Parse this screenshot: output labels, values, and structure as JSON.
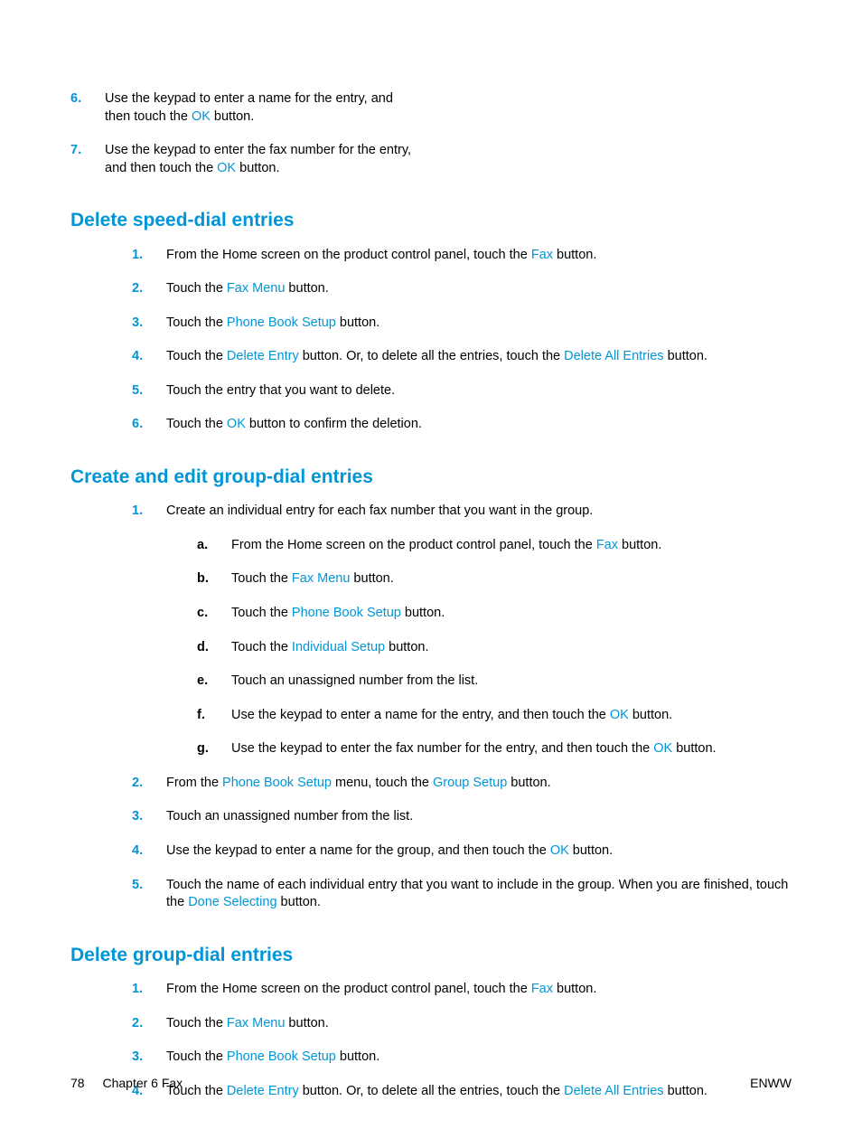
{
  "intro_steps": [
    {
      "n": "6.",
      "parts": [
        {
          "t": "Use the keypad to enter a name for the entry, and then touch the "
        },
        {
          "t": "OK",
          "c": "hp-blue"
        },
        {
          "t": " button."
        }
      ]
    },
    {
      "n": "7.",
      "parts": [
        {
          "t": "Use the keypad to enter the fax number for the entry, and then touch the "
        },
        {
          "t": "OK",
          "c": "hp-blue"
        },
        {
          "t": " button."
        }
      ]
    }
  ],
  "h_delete_speed": "Delete speed-dial entries",
  "delete_speed_steps": [
    {
      "n": "1.",
      "parts": [
        {
          "t": "From the Home screen on the product control panel, touch the "
        },
        {
          "t": "Fax",
          "c": "hp-blue"
        },
        {
          "t": " button."
        }
      ]
    },
    {
      "n": "2.",
      "parts": [
        {
          "t": "Touch the "
        },
        {
          "t": "Fax Menu",
          "c": "hp-blue"
        },
        {
          "t": " button."
        }
      ]
    },
    {
      "n": "3.",
      "parts": [
        {
          "t": "Touch the "
        },
        {
          "t": "Phone Book Setup",
          "c": "hp-blue"
        },
        {
          "t": " button."
        }
      ]
    },
    {
      "n": "4.",
      "parts": [
        {
          "t": "Touch the "
        },
        {
          "t": "Delete Entry",
          "c": "hp-blue"
        },
        {
          "t": " button. Or, to delete all the entries, touch the "
        },
        {
          "t": "Delete All Entries",
          "c": "hp-blue"
        },
        {
          "t": " button."
        }
      ]
    },
    {
      "n": "5.",
      "parts": [
        {
          "t": "Touch the entry that you want to delete."
        }
      ]
    },
    {
      "n": "6.",
      "parts": [
        {
          "t": "Touch the "
        },
        {
          "t": "OK",
          "c": "hp-blue"
        },
        {
          "t": " button to confirm the deletion."
        }
      ]
    }
  ],
  "h_create_group": "Create and edit group-dial entries",
  "create_group_steps": [
    {
      "n": "1.",
      "parts": [
        {
          "t": "Create an individual entry for each fax number that you want in the group."
        }
      ],
      "sub": [
        {
          "n": "a.",
          "parts": [
            {
              "t": "From the Home screen on the product control panel, touch the "
            },
            {
              "t": "Fax",
              "c": "hp-blue"
            },
            {
              "t": " button."
            }
          ]
        },
        {
          "n": "b.",
          "parts": [
            {
              "t": "Touch the "
            },
            {
              "t": "Fax Menu",
              "c": "hp-blue"
            },
            {
              "t": " button."
            }
          ]
        },
        {
          "n": "c.",
          "parts": [
            {
              "t": "Touch the "
            },
            {
              "t": "Phone Book Setup",
              "c": "hp-blue"
            },
            {
              "t": " button."
            }
          ]
        },
        {
          "n": "d.",
          "parts": [
            {
              "t": "Touch the "
            },
            {
              "t": "Individual Setup",
              "c": "hp-blue"
            },
            {
              "t": " button."
            }
          ]
        },
        {
          "n": "e.",
          "parts": [
            {
              "t": "Touch an unassigned number from the list."
            }
          ]
        },
        {
          "n": "f.",
          "parts": [
            {
              "t": "Use the keypad to enter a name for the entry, and then touch the "
            },
            {
              "t": "OK",
              "c": "hp-blue"
            },
            {
              "t": " button."
            }
          ]
        },
        {
          "n": "g.",
          "parts": [
            {
              "t": "Use the keypad to enter the fax number for the entry, and then touch the "
            },
            {
              "t": "OK",
              "c": "hp-blue"
            },
            {
              "t": " button."
            }
          ]
        }
      ]
    },
    {
      "n": "2.",
      "parts": [
        {
          "t": "From the "
        },
        {
          "t": "Phone Book Setup",
          "c": "hp-blue"
        },
        {
          "t": " menu, touch the "
        },
        {
          "t": "Group Setup",
          "c": "hp-blue"
        },
        {
          "t": " button."
        }
      ]
    },
    {
      "n": "3.",
      "parts": [
        {
          "t": "Touch an unassigned number from the list."
        }
      ]
    },
    {
      "n": "4.",
      "parts": [
        {
          "t": "Use the keypad to enter a name for the group, and then touch the "
        },
        {
          "t": "OK",
          "c": "hp-blue"
        },
        {
          "t": " button."
        }
      ]
    },
    {
      "n": "5.",
      "parts": [
        {
          "t": "Touch the name of each individual entry that you want to include in the group. When you are finished, touch the "
        },
        {
          "t": "Done Selecting",
          "c": "hp-blue"
        },
        {
          "t": " button."
        }
      ]
    }
  ],
  "h_delete_group": "Delete group-dial entries",
  "delete_group_steps": [
    {
      "n": "1.",
      "parts": [
        {
          "t": "From the Home screen on the product control panel, touch the "
        },
        {
          "t": "Fax",
          "c": "hp-blue"
        },
        {
          "t": " button."
        }
      ]
    },
    {
      "n": "2.",
      "parts": [
        {
          "t": "Touch the "
        },
        {
          "t": "Fax Menu",
          "c": "hp-blue"
        },
        {
          "t": " button."
        }
      ]
    },
    {
      "n": "3.",
      "parts": [
        {
          "t": "Touch the "
        },
        {
          "t": "Phone Book Setup",
          "c": "hp-blue"
        },
        {
          "t": " button."
        }
      ]
    },
    {
      "n": "4.",
      "parts": [
        {
          "t": "Touch the "
        },
        {
          "t": "Delete Entry",
          "c": "hp-blue"
        },
        {
          "t": " button. Or, to delete all the entries, touch the "
        },
        {
          "t": "Delete All Entries",
          "c": "hp-blue"
        },
        {
          "t": " button."
        }
      ]
    }
  ],
  "footer": {
    "page": "78",
    "chapter": "Chapter 6   Fax",
    "right": "ENWW"
  }
}
